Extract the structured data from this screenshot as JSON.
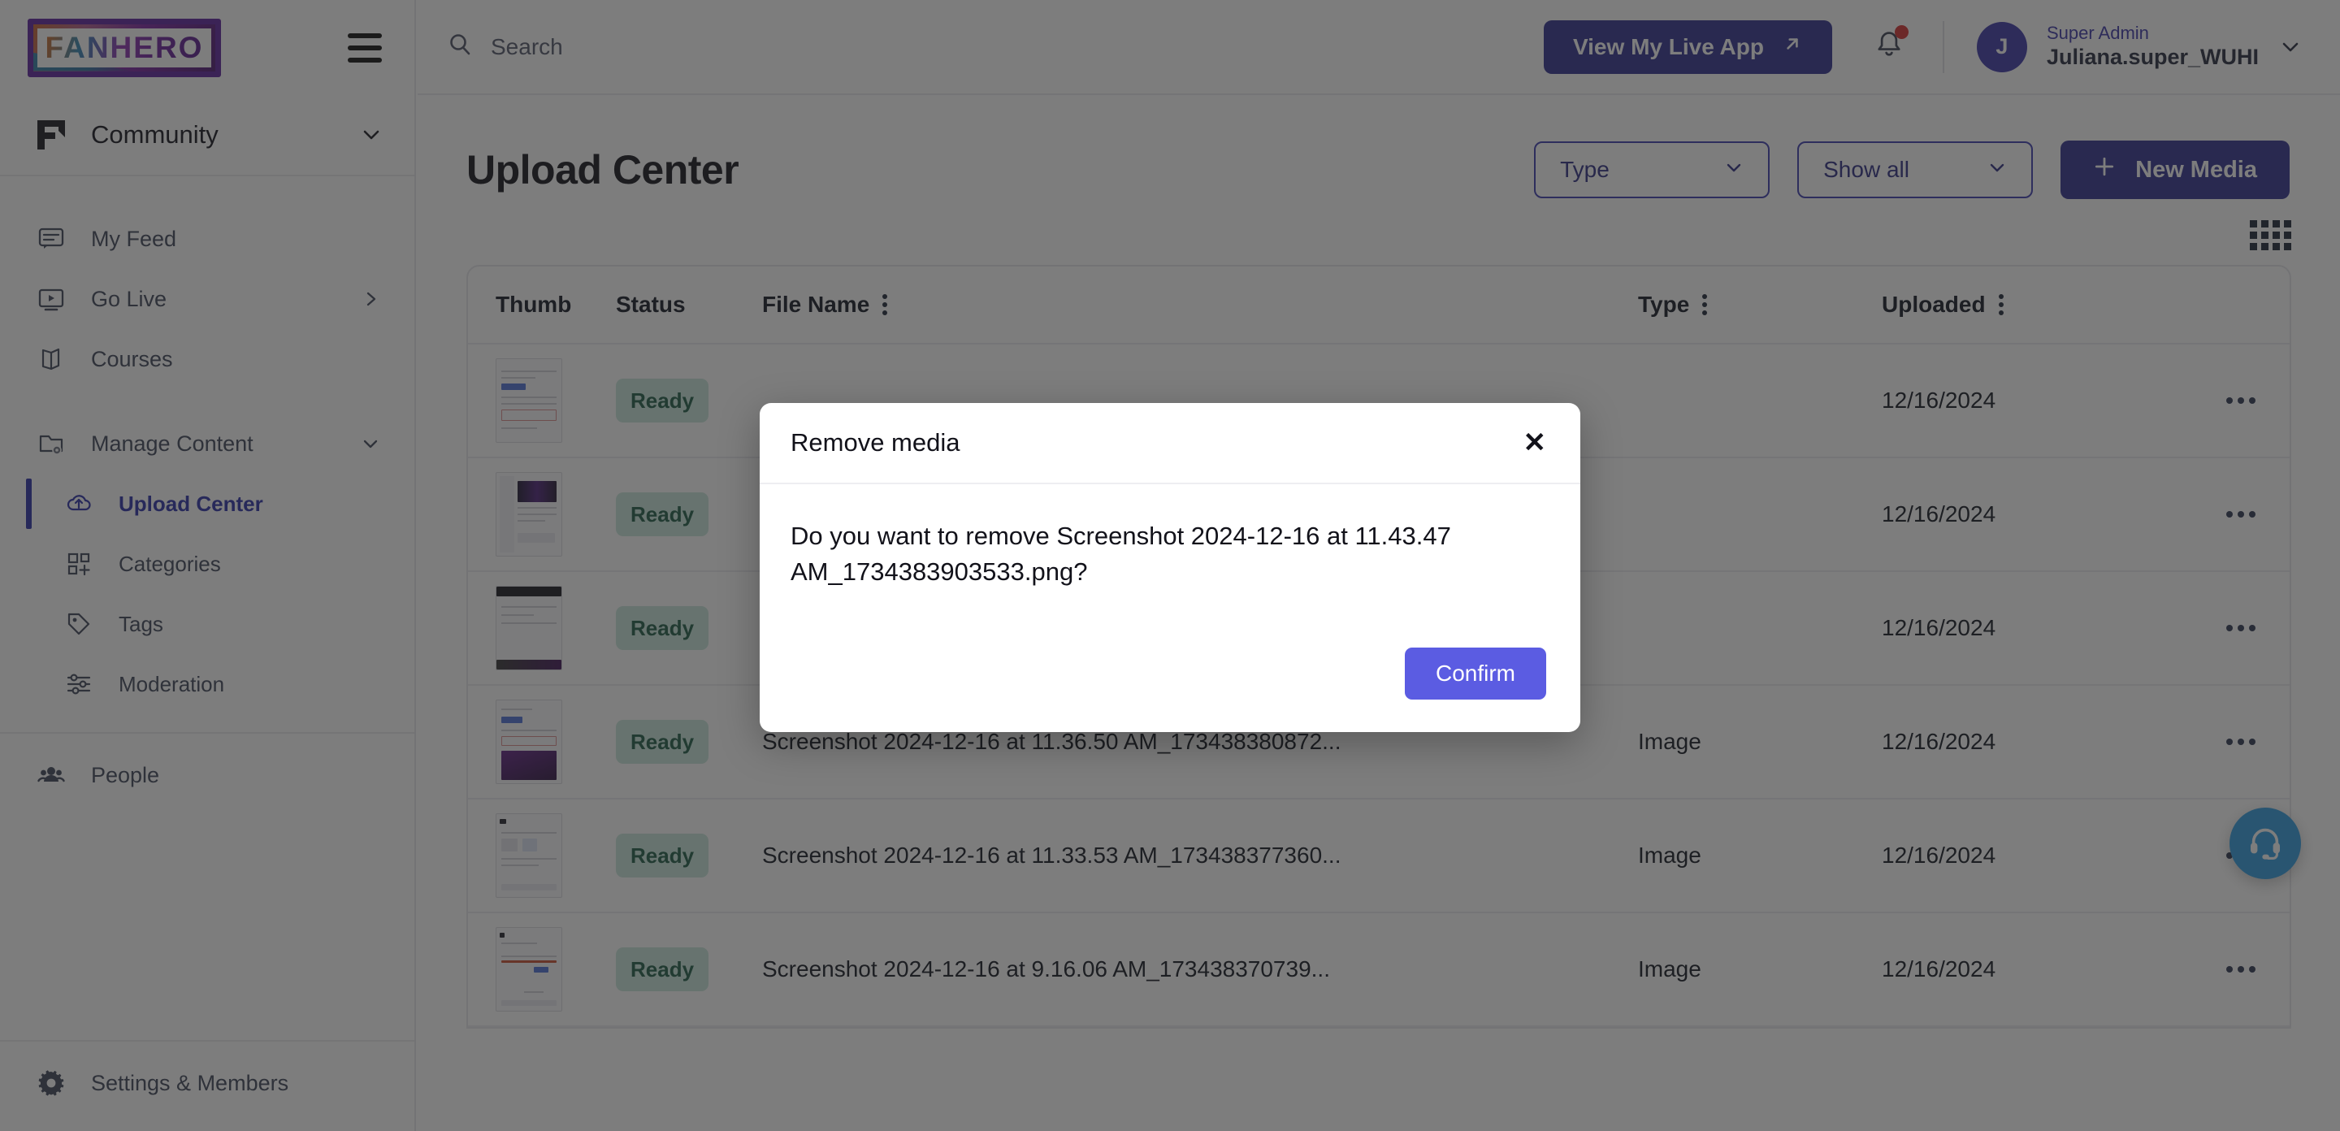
{
  "brand": {
    "logo_text": "FANHERO",
    "menu_icon": "hamburger-icon"
  },
  "sidebar": {
    "community": {
      "label": "Community",
      "chevron": "chevron-down-icon"
    },
    "items": [
      {
        "label": "My Feed",
        "icon": "feed-icon",
        "active": false,
        "sub": false
      },
      {
        "label": "Go Live",
        "icon": "live-video-icon",
        "active": false,
        "sub": false,
        "tail": "chevron-right-icon"
      },
      {
        "label": "Courses",
        "icon": "book-icon",
        "active": false,
        "sub": false
      },
      {
        "label": "Manage Content",
        "icon": "folder-gear-icon",
        "active": false,
        "sub": false,
        "tail": "chevron-down-icon"
      },
      {
        "label": "Upload Center",
        "icon": "cloud-upload-icon",
        "active": true,
        "sub": true
      },
      {
        "label": "Categories",
        "icon": "categories-icon",
        "active": false,
        "sub": true
      },
      {
        "label": "Tags",
        "icon": "tag-icon",
        "active": false,
        "sub": true
      },
      {
        "label": "Moderation",
        "icon": "sliders-icon",
        "active": false,
        "sub": true
      }
    ],
    "footer_items": [
      {
        "label": "People",
        "icon": "people-icon"
      },
      {
        "label": "Settings & Members",
        "icon": "gear-icon"
      }
    ]
  },
  "header": {
    "search": {
      "placeholder": "Search",
      "value": "",
      "icon": "search-icon"
    },
    "live_app_button": {
      "label": "View My Live App",
      "icon": "arrow-up-right-icon"
    },
    "notifications": {
      "icon": "bell-icon",
      "has_unread": true,
      "dot_color": "#d42d2d"
    },
    "user": {
      "avatar_initial": "J",
      "role": "Super Admin",
      "name": "Juliana.super_WUHI",
      "chevron": "chevron-down-icon"
    }
  },
  "page": {
    "title": "Upload Center",
    "filters": [
      {
        "label": "Type",
        "icon": "chevron-down-icon"
      },
      {
        "label": "Show all",
        "icon": "chevron-down-icon"
      }
    ],
    "new_media_button": {
      "label": "New Media",
      "icon": "plus-icon"
    },
    "view_toggle": {
      "icon": "grid-view-icon"
    }
  },
  "table": {
    "columns": [
      {
        "key": "thumb",
        "label": "Thumb",
        "menu": false
      },
      {
        "key": "status",
        "label": "Status",
        "menu": false
      },
      {
        "key": "name",
        "label": "File Name",
        "menu": true
      },
      {
        "key": "type",
        "label": "Type",
        "menu": true
      },
      {
        "key": "upl",
        "label": "Uploaded",
        "menu": true
      }
    ],
    "rows": [
      {
        "status": "Ready",
        "name": "",
        "type": "",
        "uploaded": "12/16/2024",
        "actions_icon": "more-horizontal-icon"
      },
      {
        "status": "Ready",
        "name": "",
        "type": "",
        "uploaded": "12/16/2024",
        "actions_icon": "more-horizontal-icon"
      },
      {
        "status": "Ready",
        "name": "",
        "type": "",
        "uploaded": "12/16/2024",
        "actions_icon": "more-horizontal-icon"
      },
      {
        "status": "Ready",
        "name": "Screenshot 2024-12-16 at 11.36.50 AM_173438380872...",
        "type": "Image",
        "uploaded": "12/16/2024",
        "actions_icon": "more-horizontal-icon"
      },
      {
        "status": "Ready",
        "name": "Screenshot 2024-12-16 at 11.33.53 AM_173438377360...",
        "type": "Image",
        "uploaded": "12/16/2024",
        "actions_icon": "more-horizontal-icon"
      },
      {
        "status": "Ready",
        "name": "Screenshot 2024-12-16 at 9.16.06 AM_173438370739...",
        "type": "Image",
        "uploaded": "12/16/2024",
        "actions_icon": "more-horizontal-icon"
      }
    ]
  },
  "support_widget": {
    "icon": "headset-icon",
    "color": "#2e9be0"
  },
  "modal": {
    "title": "Remove media",
    "close_label": "✕",
    "message": "Do you want to remove Screenshot 2024-12-16 at 11.43.47 AM_1734383903533.png?",
    "confirm_label": "Confirm"
  },
  "colors": {
    "accent_indigo": "#2f2f8f",
    "confirm_purple": "#5b5ce2",
    "status_bg": "#c9e7dc",
    "status_text": "#1d5a45",
    "support_blue": "#2e9be0",
    "notification_red": "#d42d2d"
  }
}
